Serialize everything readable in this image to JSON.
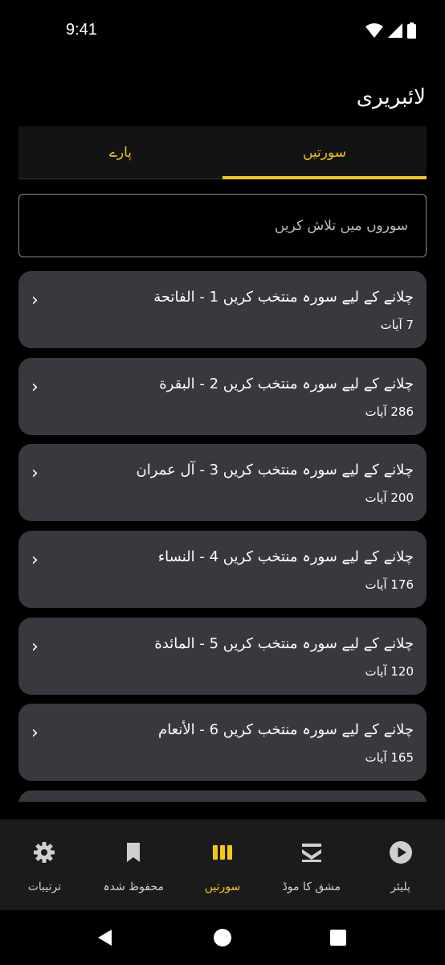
{
  "status": {
    "time": "9:41"
  },
  "header": {
    "title": "لائبریری"
  },
  "tabs": [
    {
      "label": "سورتیں",
      "active": true
    },
    {
      "label": "پارے",
      "active": false
    }
  ],
  "search": {
    "placeholder": "سوروں میں تلاش کریں",
    "value": ""
  },
  "surahs": [
    {
      "title": "چلانے کے لیے سورہ منتخب کریں 1 - الفاتحة",
      "subtitle": "7 آیات"
    },
    {
      "title": "چلانے کے لیے سورہ منتخب کریں 2 - البقرة",
      "subtitle": "286 آیات"
    },
    {
      "title": "چلانے کے لیے سورہ منتخب کریں 3 - آل عمران",
      "subtitle": "200 آیات"
    },
    {
      "title": "چلانے کے لیے سورہ منتخب کریں 4 - النساء",
      "subtitle": "176 آیات"
    },
    {
      "title": "چلانے کے لیے سورہ منتخب کریں 5 - المائدة",
      "subtitle": "120 آیات"
    },
    {
      "title": "چلانے کے لیے سورہ منتخب کریں 6 - الأنعام",
      "subtitle": "165 آیات"
    }
  ],
  "bottom_nav": [
    {
      "label": "پلیئر",
      "icon": "play-circle-icon",
      "active": false
    },
    {
      "label": "مشق کا موڈ",
      "icon": "stack-icon",
      "active": false
    },
    {
      "label": "سورتیں",
      "icon": "library-icon",
      "active": true
    },
    {
      "label": "محفوظ شدہ",
      "icon": "bookmark-icon",
      "active": false
    },
    {
      "label": "ترتیبات",
      "icon": "gear-icon",
      "active": false
    }
  ],
  "colors": {
    "accent": "#f6c712",
    "card": "#38383e",
    "nav_bg": "#1b1b1b",
    "icon_gray": "#cfcfcf"
  }
}
